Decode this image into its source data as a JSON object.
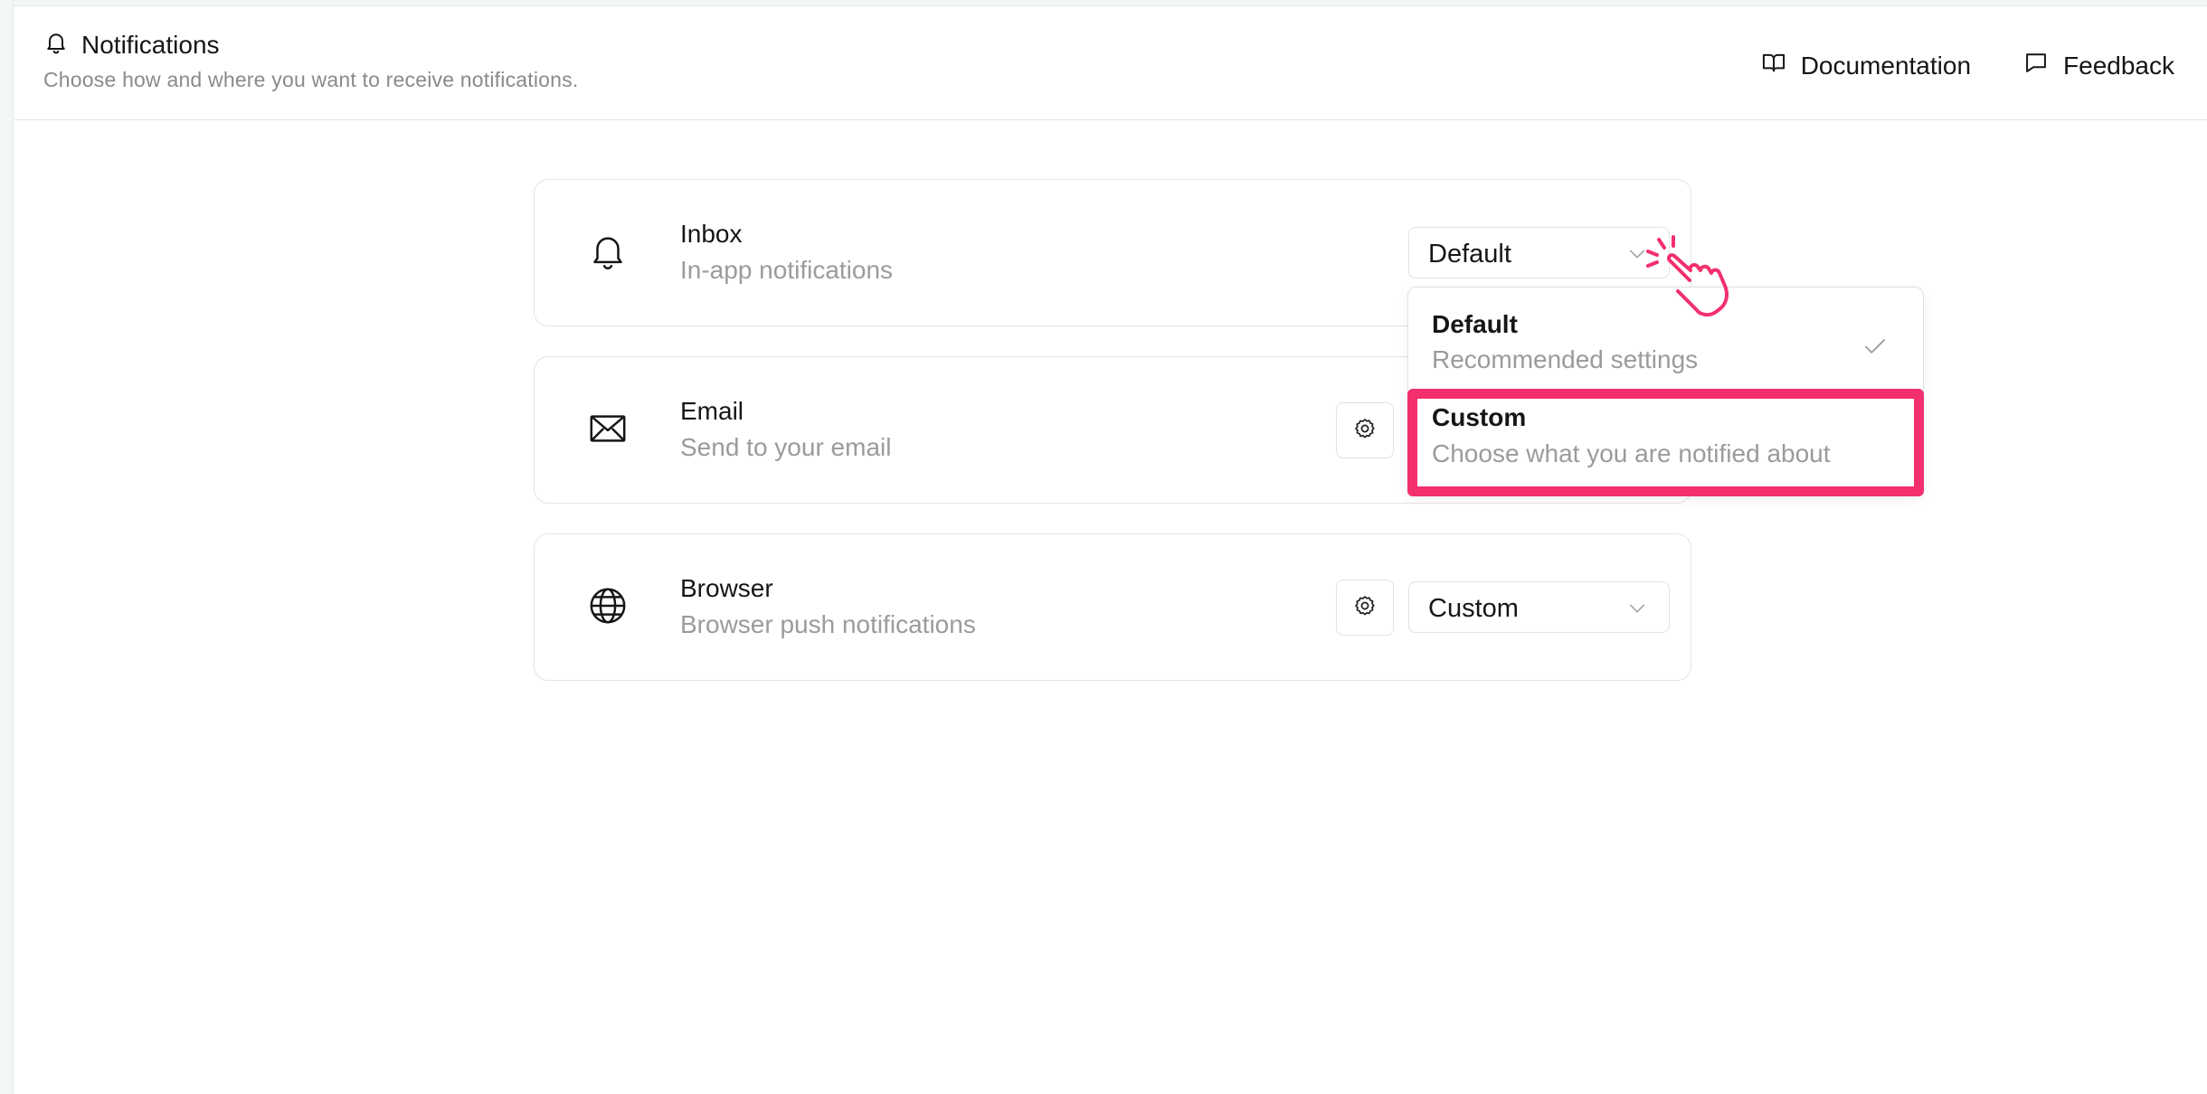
{
  "header": {
    "title": "Notifications",
    "subtitle": "Choose how and where you want to receive notifications.",
    "title_icon": "bell-icon",
    "links": [
      {
        "label": "Documentation",
        "icon": "book-icon"
      },
      {
        "label": "Feedback",
        "icon": "message-icon"
      }
    ]
  },
  "channels": [
    {
      "name": "Inbox",
      "description": "In-app notifications",
      "icon": "bell-icon",
      "value": "Default",
      "has_settings": false
    },
    {
      "name": "Email",
      "description": "Send to your email",
      "icon": "envelope-icon",
      "value": "Custom",
      "has_settings": true
    },
    {
      "name": "Browser",
      "description": "Browser push notifications",
      "icon": "globe-icon",
      "value": "Custom",
      "has_settings": true
    }
  ],
  "dropdown": {
    "options": [
      {
        "label": "Default",
        "sub": "Recommended settings",
        "selected": true
      },
      {
        "label": "Custom",
        "sub": "Choose what you are notified about",
        "highlighted": true
      }
    ]
  },
  "colors": {
    "highlight": "#f2306d",
    "muted_text": "#9b9b9b",
    "border": "#e4e4e4"
  }
}
